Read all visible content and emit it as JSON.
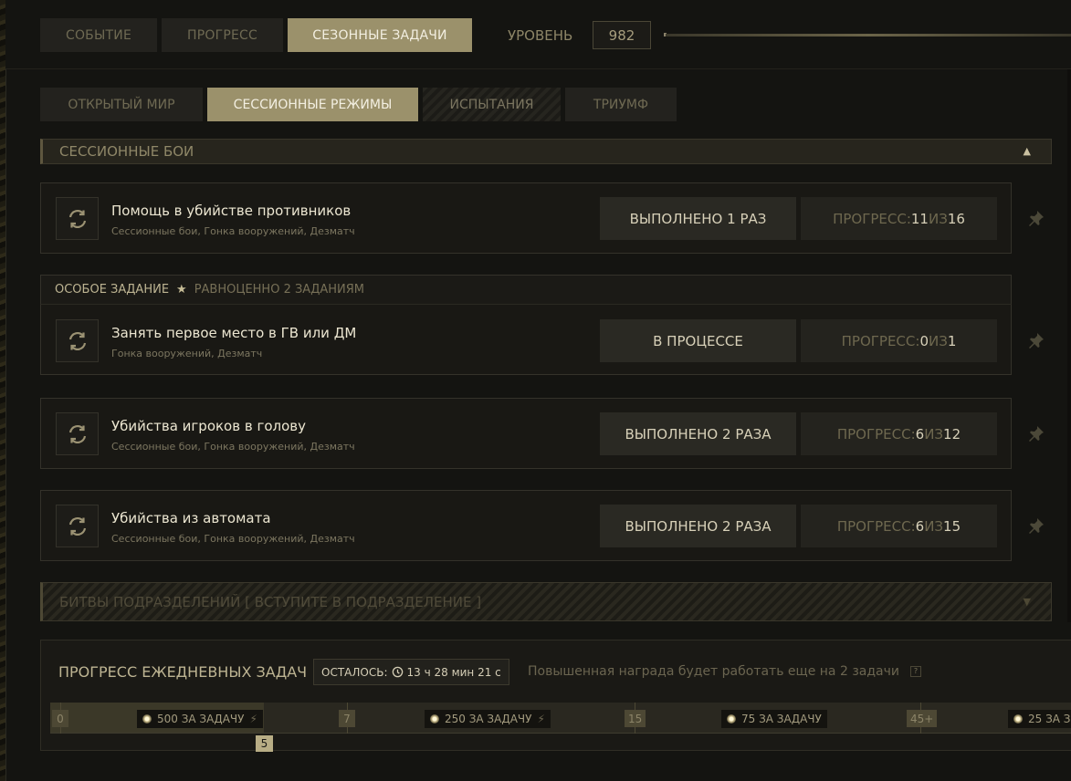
{
  "top_tabs": [
    {
      "label": "Событие",
      "active": false
    },
    {
      "label": "Прогресс",
      "active": false
    },
    {
      "label": "Сезонные задачи",
      "active": true
    }
  ],
  "level": {
    "label": "Уровень",
    "value": "982"
  },
  "sub_tabs": [
    {
      "label": "Открытый мир",
      "active": false
    },
    {
      "label": "Сессионные режимы",
      "active": true
    },
    {
      "label": "Испытания",
      "active": false
    },
    {
      "label": "Триумф",
      "active": false
    }
  ],
  "section": {
    "title": "Сессионные бои"
  },
  "special": {
    "label": "Особое задание",
    "equiv": "Равноценно 2 заданиям"
  },
  "tasks": [
    {
      "name": "Помощь в убийстве противников",
      "modes": "Сессионные бои, Гонка вооружений, Дезматч",
      "status": "Выполнено 1 раз",
      "progress_label": "Прогресс:",
      "current": "11",
      "of": "из",
      "total": "16"
    },
    {
      "name": "Занять первое место в ГВ или ДМ",
      "modes": "Гонка вооружений, Дезматч",
      "status": "В процессе",
      "progress_label": "Прогресс:",
      "current": "0",
      "of": "из",
      "total": "1"
    },
    {
      "name": "Убийства игроков в голову",
      "modes": "Сессионные бои, Гонка вооружений, Дезматч",
      "status": "Выполнено 2 раза",
      "progress_label": "Прогресс:",
      "current": "6",
      "of": "из",
      "total": "12"
    },
    {
      "name": "Убийства из автомата",
      "modes": "Сессионные бои, Гонка вооружений, Дезматч",
      "status": "Выполнено 2 раза",
      "progress_label": "Прогресс:",
      "current": "6",
      "of": "из",
      "total": "15"
    }
  ],
  "locked_section": {
    "title": "Битвы подразделений [ Вступите в подразделение ]"
  },
  "daily": {
    "title": "Прогресс ежедневных задач",
    "remaining_label": "Осталось:",
    "remaining_time": "13 ч 28 мин 21 с",
    "boost_text": "Повышенная награда будет работать еще на 2 задачи",
    "help": "?",
    "current": "5",
    "current_fraction": 0.076,
    "marks": [
      "0",
      "7",
      "15",
      "45+"
    ],
    "rewards": [
      "500 за задачу",
      "250 за задачу",
      "75 за задачу",
      "25 за з"
    ],
    "bolt": "⚡"
  }
}
